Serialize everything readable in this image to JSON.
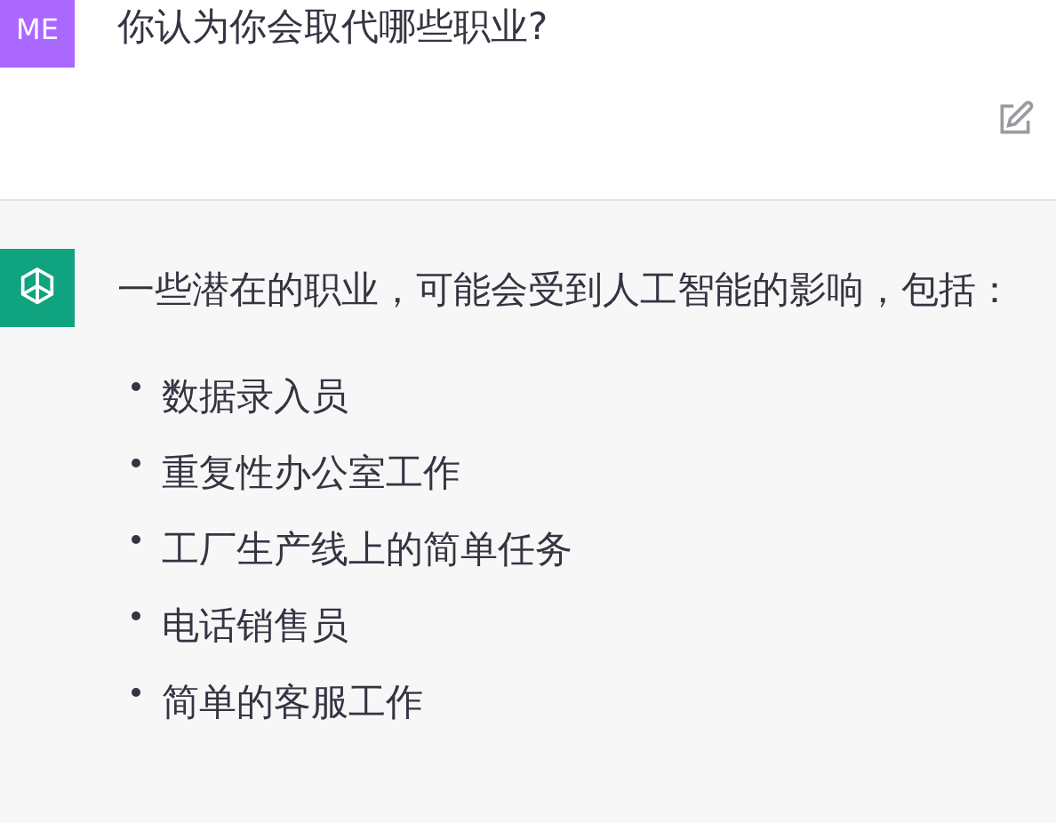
{
  "user_message": {
    "avatar": "ME",
    "text": "你认为你会取代哪些职业?"
  },
  "assistant_message": {
    "intro": "一些潜在的职业，可能会受到人工智能的影响，包括：",
    "items": [
      "数据录入员",
      "重复性办公室工作",
      "工厂生产线上的简单任务",
      "电话销售员",
      "简单的客服工作"
    ]
  }
}
